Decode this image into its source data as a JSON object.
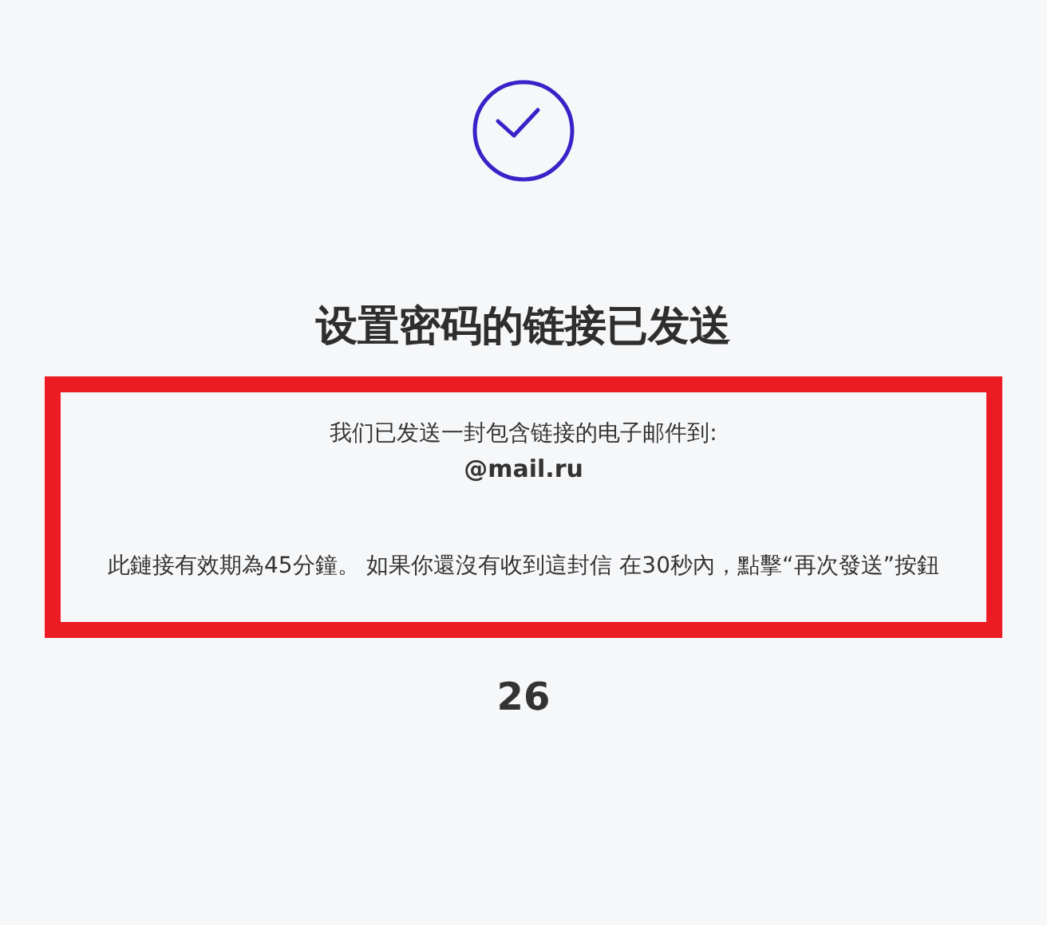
{
  "title": "设置密码的链接已发送",
  "notice": {
    "sent_text": "我们已发送一封包含链接的电子邮件到:",
    "email": "@mail.ru",
    "expiry_text": "此鏈接有效期為45分鐘。 如果你還沒有收到這封信 在30秒內，點擊“再次發送”按鈕"
  },
  "countdown": "26"
}
